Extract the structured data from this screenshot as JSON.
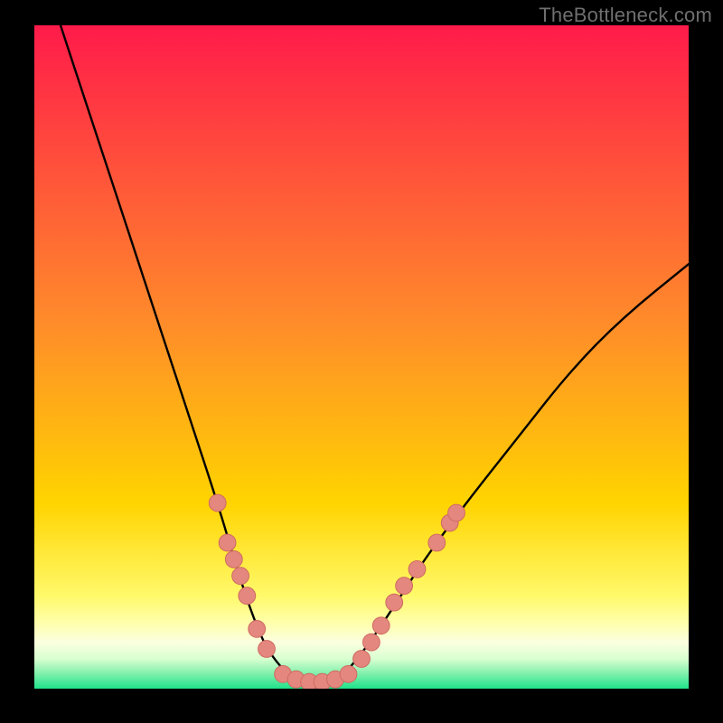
{
  "watermark": "TheBottleneck.com",
  "colors": {
    "frame": "#000000",
    "curve": "#000000",
    "dot_fill": "#e4877e",
    "dot_stroke": "#cf6a61",
    "grad_top": "#ff1b4a",
    "grad_mid": "#ffd400",
    "grad_band": "#ffffaa",
    "grad_bottom": "#1fe28a"
  },
  "chart_data": {
    "type": "line",
    "title": "",
    "xlabel": "",
    "ylabel": "",
    "xlim": [
      0,
      100
    ],
    "ylim": [
      0,
      100
    ],
    "grid": false,
    "legend": false,
    "series": [
      {
        "name": "bottleneck-curve",
        "x": [
          4,
          8,
          12,
          16,
          20,
          24,
          28,
          31,
          33,
          35,
          37,
          39,
          41,
          43,
          45,
          47,
          49,
          52,
          56,
          60,
          66,
          74,
          82,
          90,
          100
        ],
        "y": [
          100,
          88,
          76,
          64,
          52,
          40,
          28,
          18,
          12,
          7,
          4,
          2,
          1,
          1,
          1,
          2,
          4,
          8,
          14,
          20,
          28,
          38,
          48,
          56,
          64
        ]
      }
    ],
    "points": [
      {
        "name": "left-dot",
        "x": 28.0,
        "y": 28.0
      },
      {
        "name": "left-dot",
        "x": 29.5,
        "y": 22.0
      },
      {
        "name": "left-dot",
        "x": 30.5,
        "y": 19.5
      },
      {
        "name": "left-dot",
        "x": 31.5,
        "y": 17.0
      },
      {
        "name": "left-dot",
        "x": 32.5,
        "y": 14.0
      },
      {
        "name": "left-dot",
        "x": 34.0,
        "y": 9.0
      },
      {
        "name": "left-dot",
        "x": 35.5,
        "y": 6.0
      },
      {
        "name": "trough-dot",
        "x": 38.0,
        "y": 2.2
      },
      {
        "name": "trough-dot",
        "x": 40.0,
        "y": 1.4
      },
      {
        "name": "trough-dot",
        "x": 42.0,
        "y": 1.0
      },
      {
        "name": "trough-dot",
        "x": 44.0,
        "y": 1.0
      },
      {
        "name": "trough-dot",
        "x": 46.0,
        "y": 1.4
      },
      {
        "name": "trough-dot",
        "x": 48.0,
        "y": 2.2
      },
      {
        "name": "right-dot",
        "x": 50.0,
        "y": 4.5
      },
      {
        "name": "right-dot",
        "x": 51.5,
        "y": 7.0
      },
      {
        "name": "right-dot",
        "x": 53.0,
        "y": 9.5
      },
      {
        "name": "right-dot",
        "x": 55.0,
        "y": 13.0
      },
      {
        "name": "right-dot",
        "x": 56.5,
        "y": 15.5
      },
      {
        "name": "right-dot",
        "x": 58.5,
        "y": 18.0
      },
      {
        "name": "right-dot",
        "x": 61.5,
        "y": 22.0
      },
      {
        "name": "right-dot",
        "x": 63.5,
        "y": 25.0
      },
      {
        "name": "right-dot",
        "x": 64.5,
        "y": 26.5
      }
    ],
    "dot_radius_world": 1.3
  }
}
